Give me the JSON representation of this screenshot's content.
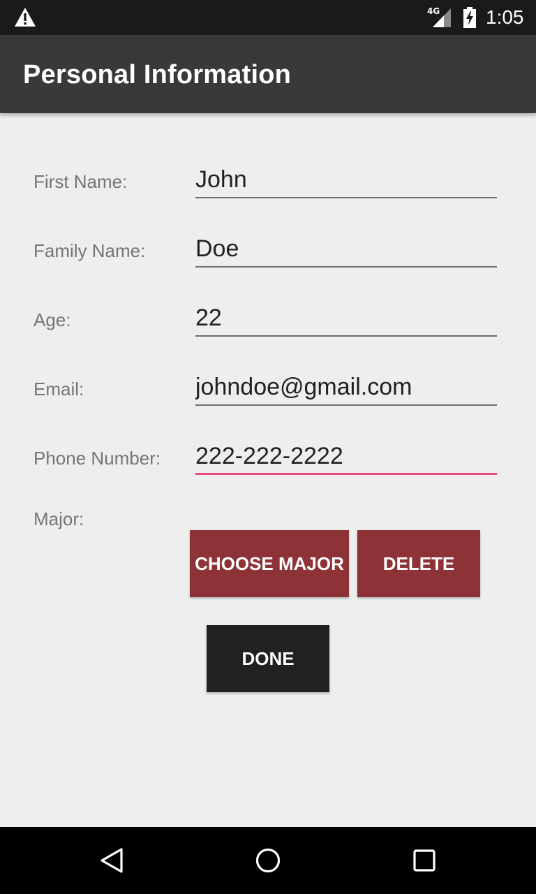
{
  "status_bar": {
    "time": "1:05",
    "network": "4G",
    "icons": [
      "warning-icon",
      "signal-icon",
      "battery-charging-icon"
    ]
  },
  "toolbar": {
    "title": "Personal Information"
  },
  "form": {
    "first_name": {
      "label": "First Name:",
      "value": "John"
    },
    "family_name": {
      "label": "Family Name:",
      "value": "Doe"
    },
    "age": {
      "label": "Age:",
      "value": "22"
    },
    "email": {
      "label": "Email:",
      "value": "johndoe@gmail.com"
    },
    "phone": {
      "label": "Phone Number:",
      "value": "222-222-2222"
    },
    "major": {
      "label": "Major:"
    }
  },
  "buttons": {
    "choose_major": "CHOOSE MAJOR",
    "delete": "DELETE",
    "done": "DONE"
  },
  "colors": {
    "toolbar": "#393939",
    "accent_focus": "#e8497f",
    "button_major": "#8d3237",
    "button_done": "#212121",
    "background": "#eeeeee"
  },
  "nav_bar": {
    "icons": [
      "back-icon",
      "home-icon",
      "recents-icon"
    ]
  }
}
